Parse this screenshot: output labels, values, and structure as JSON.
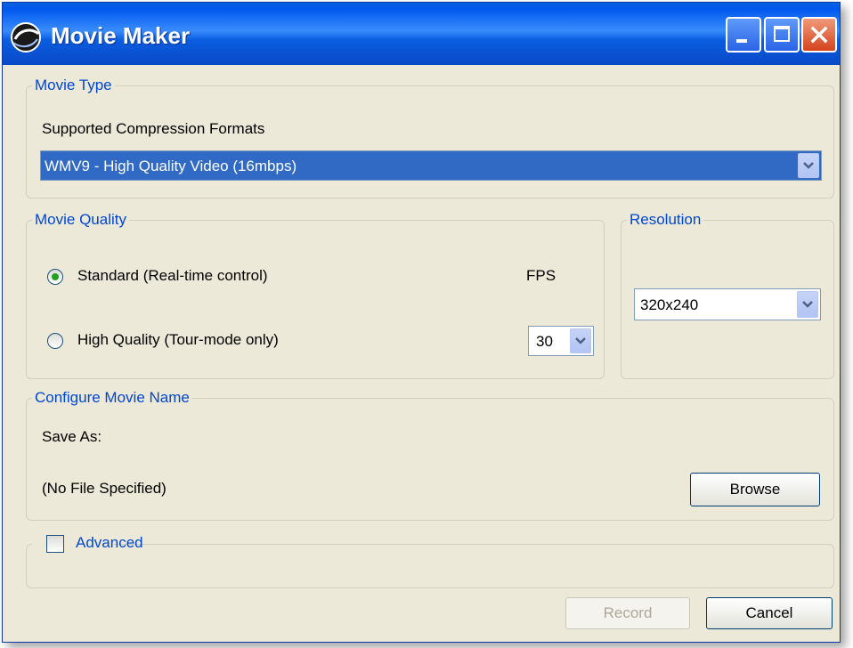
{
  "window": {
    "title": "Movie Maker",
    "icon": "movie-maker-icon"
  },
  "movie_type": {
    "legend": "Movie Type",
    "formats_label": "Supported Compression Formats",
    "selected_format": "WMV9 - High Quality Video (16mbps)"
  },
  "movie_quality": {
    "legend": "Movie Quality",
    "standard_label": "Standard (Real-time control)",
    "high_quality_label": "High Quality (Tour-mode only)",
    "selected_option": "standard",
    "fps_label": "FPS",
    "fps_value": "30"
  },
  "resolution": {
    "legend": "Resolution",
    "value": "320x240"
  },
  "movie_name": {
    "legend": "Configure Movie Name",
    "save_as_label": "Save As:",
    "file_value": "(No File Specified)",
    "browse_label": "Browse"
  },
  "advanced": {
    "label": "Advanced",
    "checked": false
  },
  "buttons": {
    "record_label": "Record",
    "record_enabled": false,
    "cancel_label": "Cancel"
  },
  "colors": {
    "title_bar": "#0a5de0",
    "group_legend": "#0046d5",
    "selection": "#316ac5",
    "dialog_bg": "#ece9d8"
  }
}
